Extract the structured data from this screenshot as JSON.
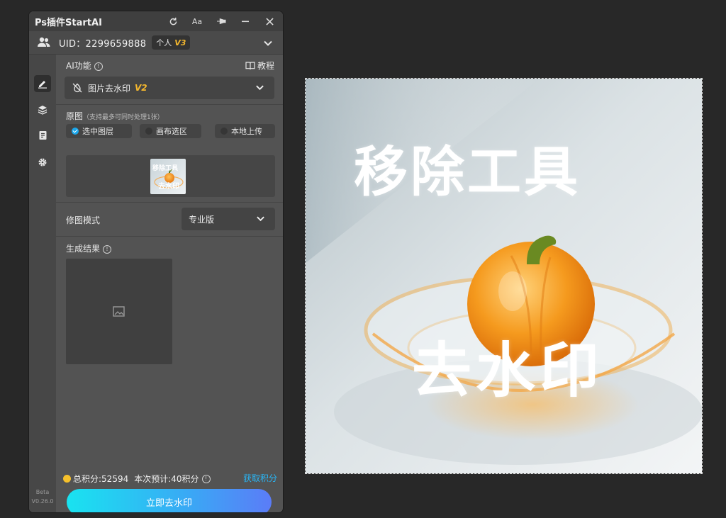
{
  "window": {
    "title": "Ps插件StartAI",
    "icons": [
      "refresh-icon",
      "font-size-icon",
      "pin-icon",
      "minimize-icon",
      "close-icon"
    ],
    "font_button_label": "Aa"
  },
  "user": {
    "uid_text": "UID：2299659888",
    "plan_label": "个人",
    "plan_version": "V3"
  },
  "sidebar": {
    "items": [
      "edit-icon",
      "layers-icon",
      "document-icon",
      "settings-icon"
    ],
    "beta_label": "Beta",
    "version": "V0.26.0"
  },
  "ai_function": {
    "label": "AI功能",
    "tutorial_label": "教程",
    "selected": "图片去水印",
    "selected_version": "V2"
  },
  "source": {
    "label": "原图",
    "hint": "（支持最多可同时处理1张）",
    "options": [
      {
        "label": "选中图层",
        "selected": true
      },
      {
        "label": "画布选区",
        "selected": false
      },
      {
        "label": "本地上传",
        "selected": false
      }
    ]
  },
  "mode": {
    "label": "修图模式",
    "selected": "专业版"
  },
  "result": {
    "label": "生成结果"
  },
  "footer": {
    "total_points": "总积分:52594",
    "estimate": "本次预计:40积分",
    "get_points_label": "获取积分",
    "action_label": "立即去水印"
  },
  "canvas": {
    "watermark_line1": "移除工具",
    "watermark_line2": "去水印",
    "thumb_line1": "移除工具",
    "thumb_line2": "去水印"
  },
  "colors": {
    "accent_blue": "#29b6f6",
    "version_gold": "#f5b82e",
    "button_gradient_start": "#19e3f0",
    "button_gradient_end": "#5b7cf7"
  }
}
